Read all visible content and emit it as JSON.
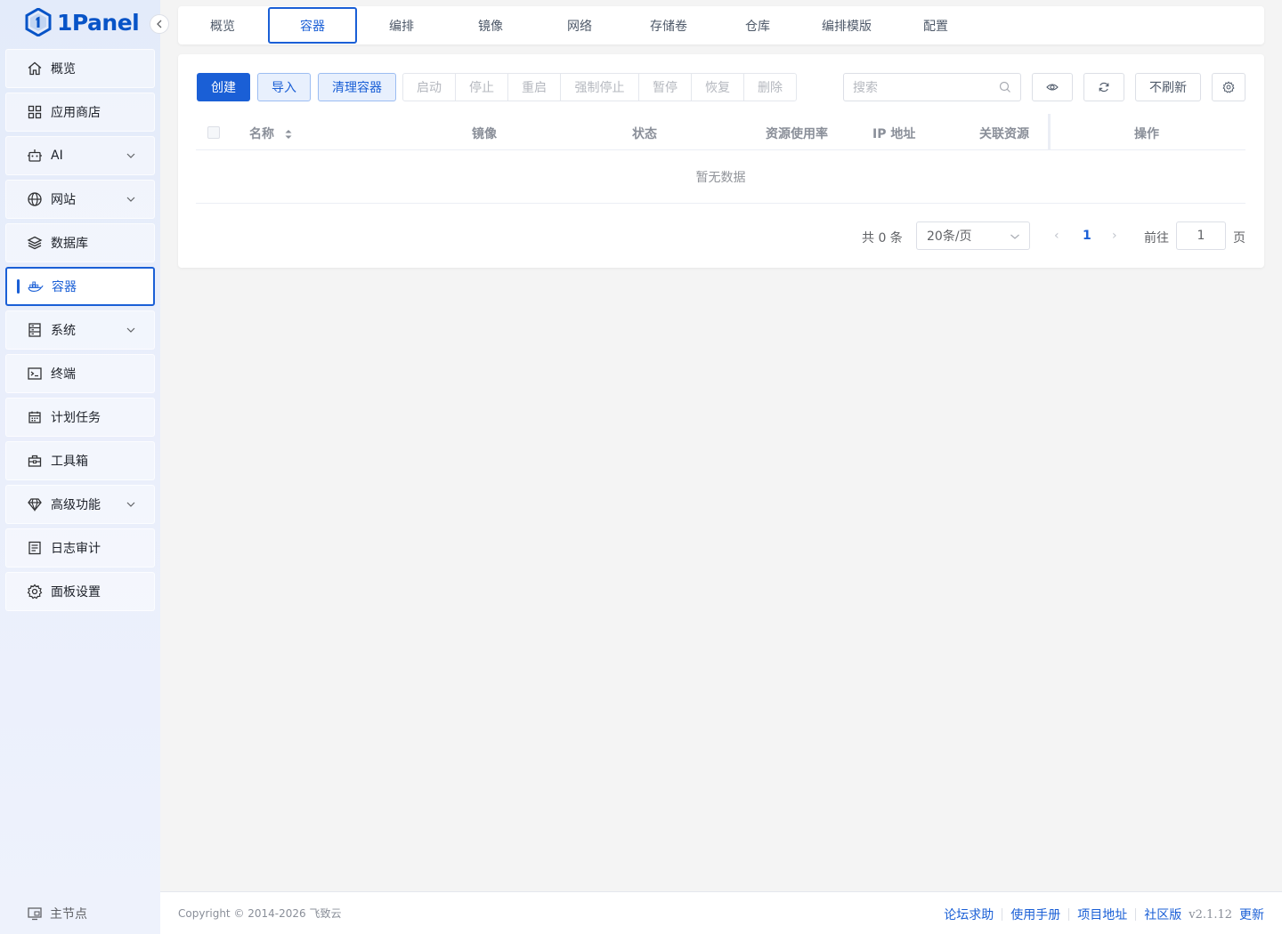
{
  "app": {
    "logo_text": "1Panel",
    "collapse_icon": "chevron-left-icon"
  },
  "sidebar": {
    "items": [
      {
        "label": "概览",
        "icon": "home-icon"
      },
      {
        "label": "应用商店",
        "icon": "grid-icon"
      },
      {
        "label": "AI",
        "icon": "robot-icon",
        "expandable": true
      },
      {
        "label": "网站",
        "icon": "globe-icon",
        "expandable": true
      },
      {
        "label": "数据库",
        "icon": "layers-icon"
      },
      {
        "label": "容器",
        "icon": "docker-icon",
        "active": true
      },
      {
        "label": "系统",
        "icon": "server-icon",
        "expandable": true
      },
      {
        "label": "终端",
        "icon": "terminal-icon"
      },
      {
        "label": "计划任务",
        "icon": "calendar-icon"
      },
      {
        "label": "工具箱",
        "icon": "toolbox-icon"
      },
      {
        "label": "高级功能",
        "icon": "diamond-icon",
        "expandable": true
      },
      {
        "label": "日志审计",
        "icon": "log-icon"
      },
      {
        "label": "面板设置",
        "icon": "gear-icon"
      }
    ],
    "node_label": "主节点"
  },
  "tabs": [
    "概览",
    "容器",
    "编排",
    "镜像",
    "网络",
    "存储卷",
    "仓库",
    "编排模版",
    "配置"
  ],
  "active_tab": "容器",
  "toolbar": {
    "create": "创建",
    "import": "导入",
    "prune": "清理容器",
    "group": [
      "启动",
      "停止",
      "重启",
      "强制停止",
      "暂停",
      "恢复",
      "删除"
    ],
    "search_placeholder": "搜索",
    "no_refresh": "不刷新"
  },
  "table": {
    "columns": [
      "名称",
      "镜像",
      "状态",
      "资源使用率",
      "IP 地址",
      "关联资源",
      "操作"
    ],
    "empty_text": "暂无数据"
  },
  "pagination": {
    "total": "共 0 条",
    "page_size": "20条/页",
    "current_page": "1",
    "goto_label": "前往",
    "goto_value": "1",
    "page_suffix": "页"
  },
  "footer": {
    "copyright": "Copyright © 2014-2026 飞致云",
    "links": [
      "论坛求助",
      "使用手册",
      "项目地址",
      "社区版"
    ],
    "version": "v2.1.12",
    "update": "更新"
  },
  "colors": {
    "primary": "#1a5fd6",
    "sidebar_bg": "#e9eefb",
    "page_bg": "#f4f4f4"
  }
}
